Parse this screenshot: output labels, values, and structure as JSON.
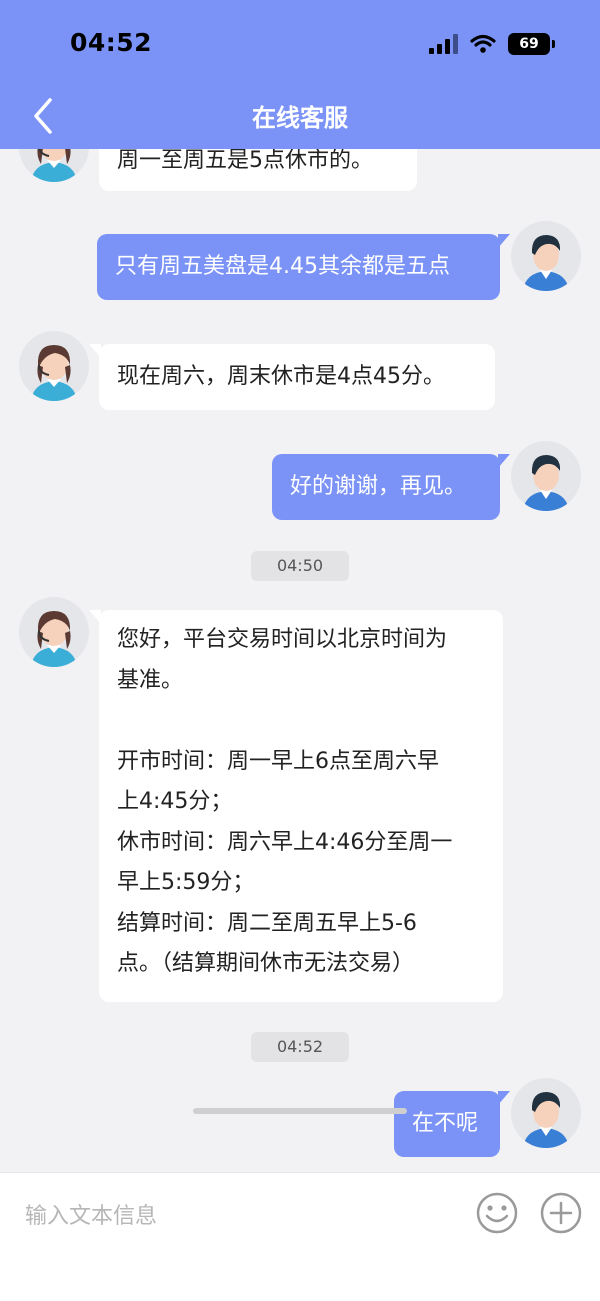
{
  "status": {
    "time": "04:52",
    "battery": "69"
  },
  "header": {
    "title": "在线客服"
  },
  "messages": [
    {
      "side": "left",
      "text": "周一至周五是5点休市的。"
    },
    {
      "side": "right",
      "text": "只有周五美盘是4.45其余都是五点"
    },
    {
      "side": "left",
      "text": "现在周六，周末休市是4点45分。"
    },
    {
      "side": "right",
      "text": "好的谢谢，再见。"
    },
    {
      "side": "time",
      "text": "04:50"
    },
    {
      "side": "left",
      "lines": [
        "您好，平台交易时间以北京时间为",
        "基准。",
        "",
        "开市时间：周一早上6点至周六早",
        "上4:45分；",
        "休市时间：周六早上4:46分至周一",
        "早上5:59分；",
        "结算时间：周二至周五早上5-6",
        "点。（结算期间休市无法交易）"
      ]
    },
    {
      "side": "time",
      "text": "04:52"
    },
    {
      "side": "right",
      "text": "在不呢"
    }
  ],
  "input": {
    "placeholder": "输入文本信息"
  },
  "colors": {
    "accent": "#7b93f7",
    "bubble_left": "#ffffff",
    "background": "#f2f2f4"
  }
}
